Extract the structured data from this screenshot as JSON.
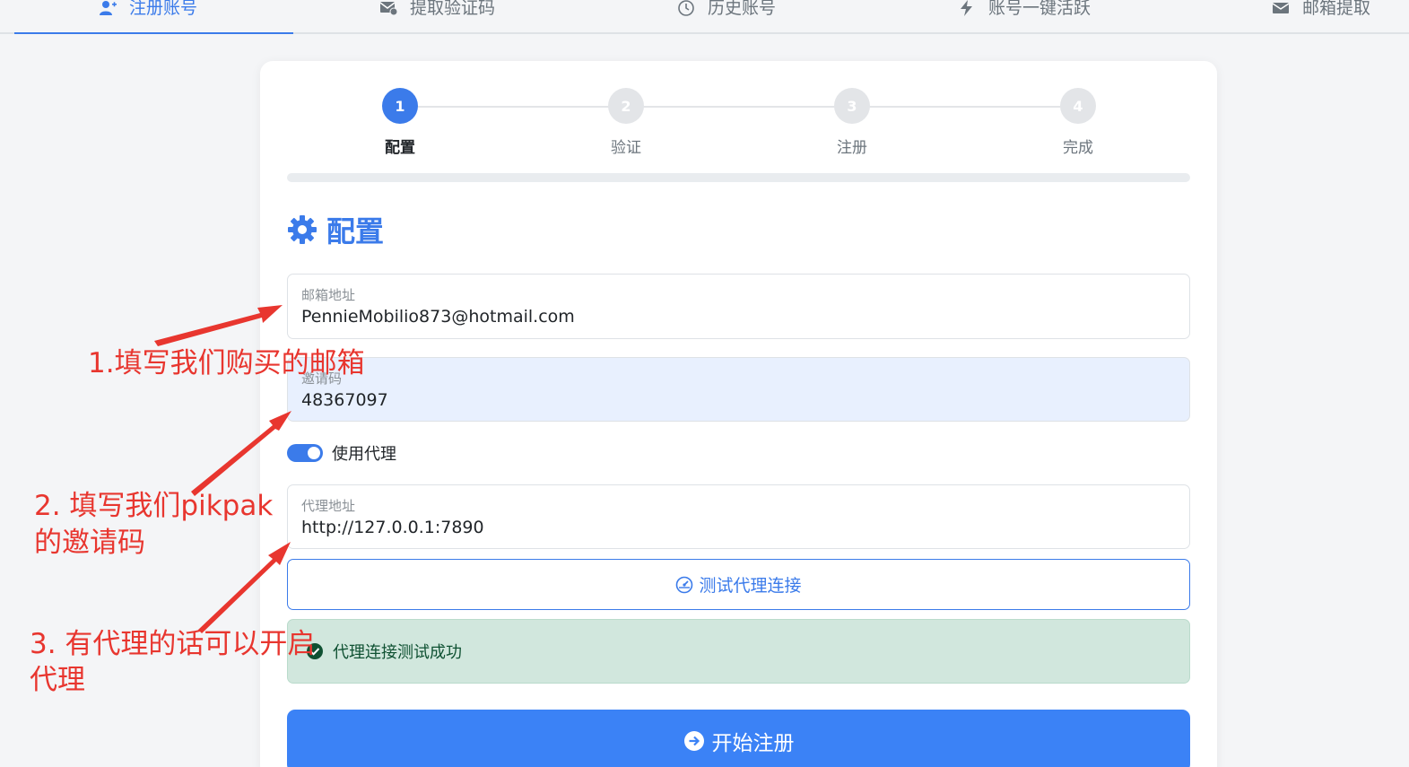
{
  "tabs": [
    {
      "label": "注册账号",
      "icon": "user-plus-icon",
      "active": true
    },
    {
      "label": "提取验证码",
      "icon": "envelope-check-icon",
      "active": false
    },
    {
      "label": "历史账号",
      "icon": "clock-icon",
      "active": false
    },
    {
      "label": "账号一键活跃",
      "icon": "bolt-icon",
      "active": false
    },
    {
      "label": "邮箱提取",
      "icon": "envelope-icon",
      "active": false
    }
  ],
  "steps": [
    {
      "num": "1",
      "label": "配置",
      "active": true
    },
    {
      "num": "2",
      "label": "验证",
      "active": false
    },
    {
      "num": "3",
      "label": "注册",
      "active": false
    },
    {
      "num": "4",
      "label": "完成",
      "active": false
    }
  ],
  "section": {
    "title": "配置",
    "icon": "gear-icon"
  },
  "form": {
    "email": {
      "label": "邮箱地址",
      "value": "PennieMobilio873@hotmail.com"
    },
    "invite": {
      "label": "邀请码",
      "value": "48367097"
    },
    "use_proxy": {
      "label": "使用代理",
      "checked": true
    },
    "proxy": {
      "label": "代理地址",
      "value": "http://127.0.0.1:7890"
    }
  },
  "test_button": {
    "label": "测试代理连接",
    "icon": "speedometer-icon"
  },
  "alert": {
    "text": "代理连接测试成功",
    "icon": "check-circle-icon"
  },
  "start_button": {
    "label": "开始注册",
    "icon": "arrow-right-circle-icon"
  },
  "annotations": {
    "a1": "1.填写我们购买的邮箱",
    "a2_line1": "2. 填写我们pikpak",
    "a2_line2": "的邀请码",
    "a3_line1": "3. 有代理的话可以开启",
    "a3_line2": "代理"
  },
  "colors": {
    "accent": "#3b7bea",
    "success_bg": "#d1e7dd",
    "annotation": "#e8362f"
  }
}
